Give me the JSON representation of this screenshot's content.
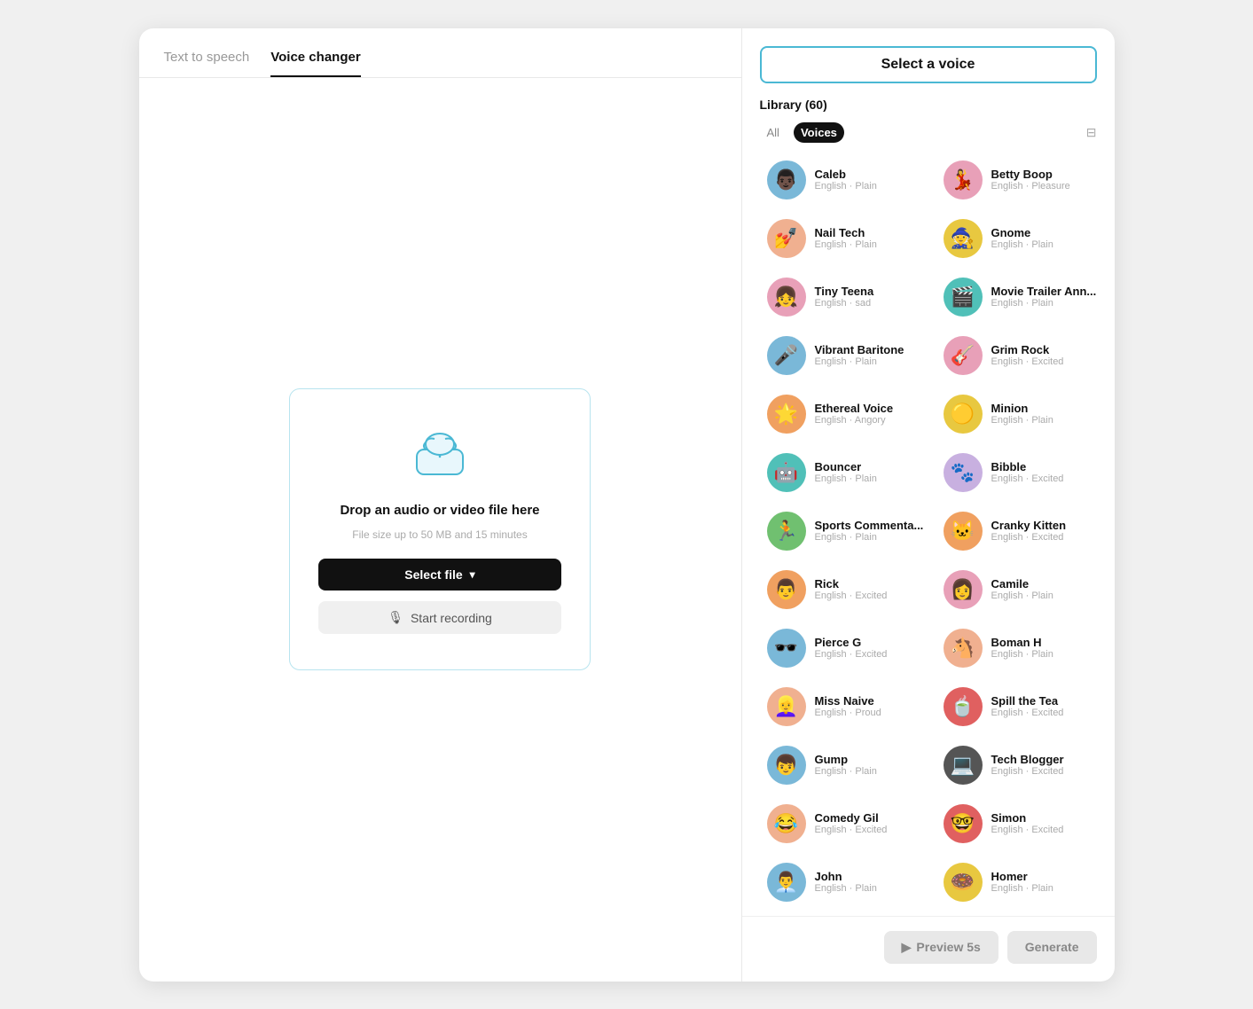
{
  "tabs": [
    {
      "id": "text-to-speech",
      "label": "Text to speech",
      "active": false
    },
    {
      "id": "voice-changer",
      "label": "Voice changer",
      "active": true
    }
  ],
  "upload": {
    "title": "Drop an audio or video file here",
    "subtitle": "File size up to 50 MB and 15 minutes",
    "select_btn": "Select file",
    "record_btn": "Start recording"
  },
  "voice_panel": {
    "header": "Select a voice",
    "library_label": "Library (60)",
    "filters": [
      {
        "label": "All",
        "active": false
      },
      {
        "label": "Voices",
        "active": true
      }
    ],
    "voices": [
      {
        "name": "Caleb",
        "lang": "English",
        "style": "Plain",
        "color": "av-blue",
        "emoji": "👨🏿"
      },
      {
        "name": "Betty Boop",
        "lang": "English",
        "style": "Pleasure",
        "color": "av-pink",
        "emoji": "💃"
      },
      {
        "name": "Nail Tech",
        "lang": "English",
        "style": "Plain",
        "color": "av-peach",
        "emoji": "💅"
      },
      {
        "name": "Gnome",
        "lang": "English",
        "style": "Plain",
        "color": "av-yellow",
        "emoji": "🧙"
      },
      {
        "name": "Tiny Teena",
        "lang": "English",
        "style": "sad",
        "color": "av-pink",
        "emoji": "👧"
      },
      {
        "name": "Movie Trailer Ann...",
        "lang": "English",
        "style": "Plain",
        "color": "av-teal",
        "emoji": "🎬"
      },
      {
        "name": "Vibrant Baritone",
        "lang": "English",
        "style": "Plain",
        "color": "av-blue",
        "emoji": "🎤"
      },
      {
        "name": "Grim Rock",
        "lang": "English",
        "style": "Excited",
        "color": "av-pink",
        "emoji": "🎸"
      },
      {
        "name": "Ethereal Voice",
        "lang": "English",
        "style": "Angory",
        "color": "av-orange",
        "emoji": "🌟"
      },
      {
        "name": "Minion",
        "lang": "English",
        "style": "Plain",
        "color": "av-yellow",
        "emoji": "🟡"
      },
      {
        "name": "Bouncer",
        "lang": "English",
        "style": "Plain",
        "color": "av-teal",
        "emoji": "🤖"
      },
      {
        "name": "Bibble",
        "lang": "English",
        "style": "Excited",
        "color": "av-purple",
        "emoji": "🐾"
      },
      {
        "name": "Sports Commenta...",
        "lang": "English",
        "style": "Plain",
        "color": "av-green",
        "emoji": "🏃"
      },
      {
        "name": "Cranky Kitten",
        "lang": "English",
        "style": "Excited",
        "color": "av-orange",
        "emoji": "🐱"
      },
      {
        "name": "Rick",
        "lang": "English",
        "style": "Excited",
        "color": "av-orange",
        "emoji": "👨"
      },
      {
        "name": "Camile",
        "lang": "English",
        "style": "Plain",
        "color": "av-pink",
        "emoji": "👩"
      },
      {
        "name": "Pierce G",
        "lang": "English",
        "style": "Excited",
        "color": "av-blue",
        "emoji": "🕶️"
      },
      {
        "name": "Boman H",
        "lang": "English",
        "style": "Plain",
        "color": "av-peach",
        "emoji": "🐴"
      },
      {
        "name": "Miss Naive",
        "lang": "English",
        "style": "Proud",
        "color": "av-peach",
        "emoji": "👱‍♀️"
      },
      {
        "name": "Spill the Tea",
        "lang": "English",
        "style": "Excited",
        "color": "av-red",
        "emoji": "🍵"
      },
      {
        "name": "Gump",
        "lang": "English",
        "style": "Plain",
        "color": "av-blue",
        "emoji": "👦"
      },
      {
        "name": "Tech Blogger",
        "lang": "English",
        "style": "Excited",
        "color": "av-dark",
        "emoji": "💻"
      },
      {
        "name": "Comedy Gil",
        "lang": "English",
        "style": "Excited",
        "color": "av-peach",
        "emoji": "😂"
      },
      {
        "name": "Simon",
        "lang": "English",
        "style": "Excited",
        "color": "av-red",
        "emoji": "🤓"
      },
      {
        "name": "John",
        "lang": "English",
        "style": "Plain",
        "color": "av-blue",
        "emoji": "👨‍💼"
      },
      {
        "name": "Homer",
        "lang": "English",
        "style": "Plain",
        "color": "av-yellow",
        "emoji": "🍩"
      }
    ],
    "preview_btn": "Preview 5s",
    "generate_btn": "Generate"
  }
}
